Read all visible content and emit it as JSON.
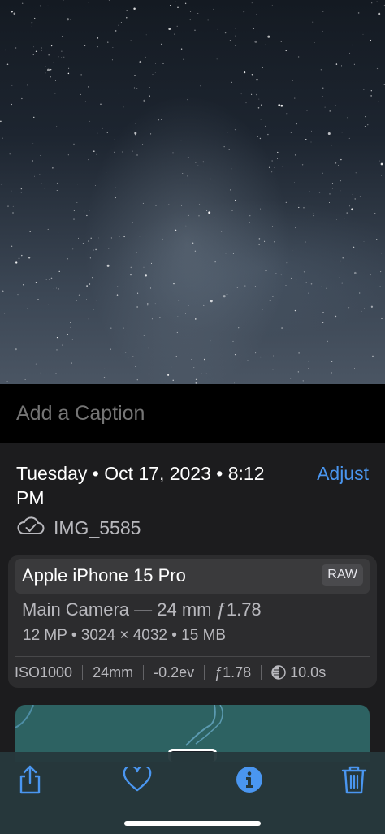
{
  "photo": {
    "alt_icon": "starry-sky-photo"
  },
  "caption": {
    "placeholder": "Add a Caption"
  },
  "details": {
    "date_time": "Tuesday • Oct 17, 2023 • 8:12 PM",
    "adjust_label": "Adjust",
    "filename": "IMG_5585",
    "cloud_icon": "cloud-check-icon"
  },
  "camera_card": {
    "device": "Apple iPhone 15 Pro",
    "format_badge": "RAW",
    "lens": "Main Camera — 24 mm ƒ1.78",
    "specs": "12 MP • 3024 × 4032 • 15 MB",
    "exif": {
      "iso": "ISO1000",
      "focal_length": "24mm",
      "exposure_bias": "-0.2ev",
      "aperture": "ƒ1.78",
      "shutter": "10.0s"
    }
  },
  "toolbar": {
    "share_icon": "share-icon",
    "favorite_icon": "heart-icon",
    "info_icon": "info-icon",
    "delete_icon": "trash-icon"
  },
  "colors": {
    "accent": "#4a96f0",
    "background": "#1c1c1e",
    "card": "#2c2c2e",
    "map": "#2d6262"
  }
}
